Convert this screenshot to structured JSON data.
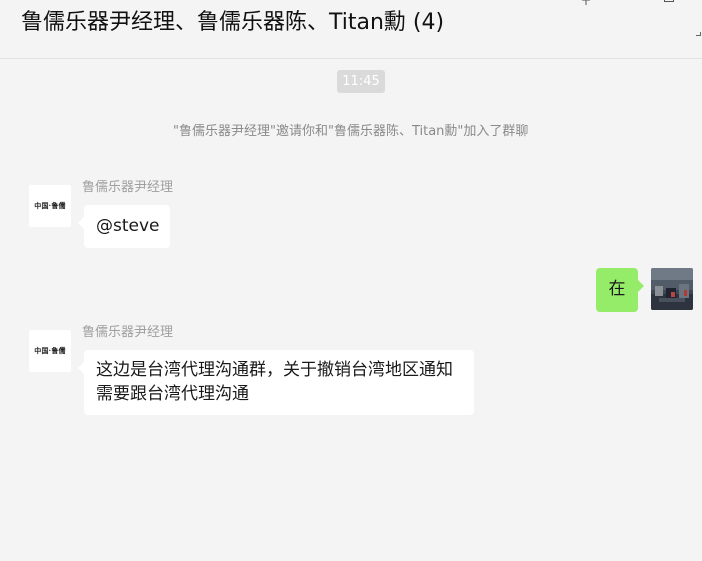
{
  "header": {
    "title": "鲁儒乐器尹经理、鲁儒乐器陈、Titan勳 (4)"
  },
  "chat": {
    "time": "11:45",
    "system_message": "\"鲁儒乐器尹经理\"邀请你和\"鲁儒乐器陈、Titan勳\"加入了群聊",
    "messages": [
      {
        "sender": "鲁儒乐器尹经理",
        "avatar_text": "中国·鲁儒",
        "text": "@steve"
      },
      {
        "sender": "me",
        "text": "在"
      },
      {
        "sender": "鲁儒乐器尹经理",
        "avatar_text": "中国·鲁儒",
        "text": "这边是台湾代理沟通群，关于撤销台湾地区通知需要跟台湾代理沟通"
      }
    ]
  },
  "colors": {
    "background": "#f4f4f4",
    "bubble_other": "#ffffff",
    "bubble_me": "#95ec69",
    "sender_name": "#9e9e9e",
    "system_text": "#8a8a8a",
    "time_pill": "#dadada"
  },
  "icons": {
    "pin": "pin-icon",
    "minimize": "minimize-icon",
    "maximize": "maximize-icon"
  }
}
